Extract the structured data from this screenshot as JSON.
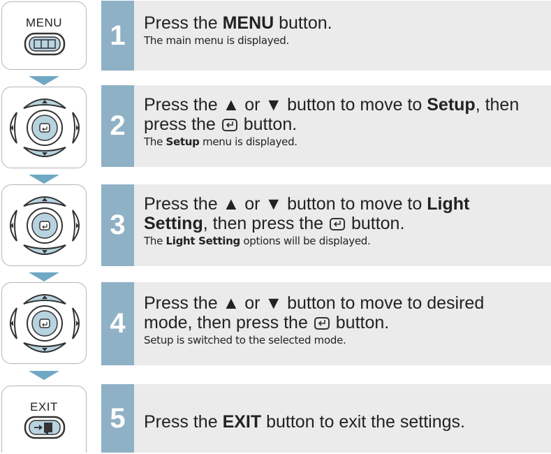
{
  "steps": [
    {
      "number": "1",
      "icon": "menu-button-icon",
      "icon_label": "MENU",
      "main_segments": [
        {
          "text": "Press the ",
          "bold": false
        },
        {
          "text": "MENU",
          "bold": true
        },
        {
          "text": " button.",
          "bold": false
        }
      ],
      "sub_segments": [
        {
          "text": "The main menu is displayed.",
          "bold": false
        }
      ]
    },
    {
      "number": "2",
      "icon": "directional-pad-icon",
      "main_segments": [
        {
          "text": "Press the ▲ or ▼ button to move to ",
          "bold": false
        },
        {
          "text": "Setup",
          "bold": true
        },
        {
          "text": ", then",
          "bold": false
        },
        {
          "br": true
        },
        {
          "text": "press the ",
          "bold": false
        },
        {
          "enter": true
        },
        {
          "text": " button.",
          "bold": false
        }
      ],
      "sub_segments": [
        {
          "text": "The ",
          "bold": false
        },
        {
          "text": "Setup",
          "bold": true
        },
        {
          "text": " menu is displayed.",
          "bold": false
        }
      ]
    },
    {
      "number": "3",
      "icon": "directional-pad-icon",
      "main_segments": [
        {
          "text": "Press the ▲ or ▼ button to move to ",
          "bold": false
        },
        {
          "text": "Light",
          "bold": true
        },
        {
          "br": true
        },
        {
          "text": "Setting",
          "bold": true
        },
        {
          "text": ", then press the ",
          "bold": false
        },
        {
          "enter": true
        },
        {
          "text": " button.",
          "bold": false
        }
      ],
      "sub_segments": [
        {
          "text": "The ",
          "bold": false
        },
        {
          "text": "Light Setting",
          "bold": true
        },
        {
          "text": " options will be displayed.",
          "bold": false
        }
      ]
    },
    {
      "number": "4",
      "icon": "directional-pad-icon",
      "main_segments": [
        {
          "text": "Press the ▲ or ▼ button to move to desired",
          "bold": false
        },
        {
          "br": true
        },
        {
          "text": "mode, then press the ",
          "bold": false
        },
        {
          "enter": true
        },
        {
          "text": " button.",
          "bold": false
        }
      ],
      "sub_segments": [
        {
          "text": "Setup is switched to the selected mode.",
          "bold": false
        }
      ]
    },
    {
      "number": "5",
      "icon": "exit-button-icon",
      "icon_label": "EXIT",
      "main_segments": [
        {
          "text": "Press the ",
          "bold": false
        },
        {
          "text": "EXIT",
          "bold": true
        },
        {
          "text": " button to exit the settings.",
          "bold": false
        }
      ],
      "sub_segments": []
    }
  ],
  "colors": {
    "number_band": "#8fb1c6",
    "panel": "#ebebeb",
    "arrow": "#6fa8c4",
    "icon_border": "#b4b4b4"
  }
}
